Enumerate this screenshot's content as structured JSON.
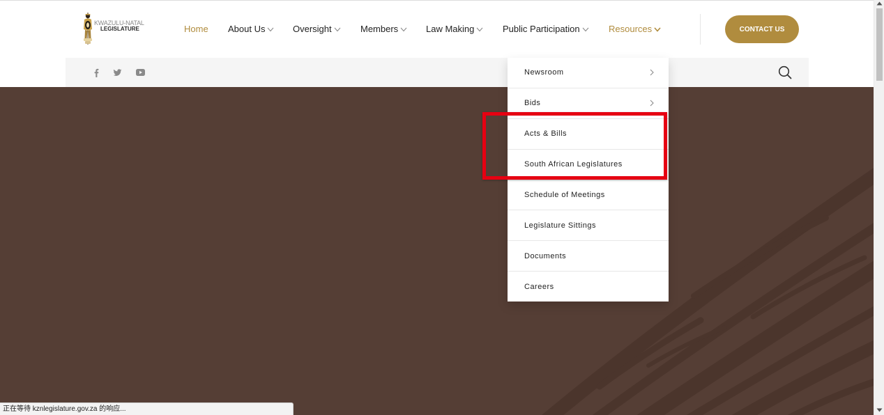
{
  "colors": {
    "accent": "#b08c3e",
    "nav_text": "#222222",
    "hero_background": "#553e35",
    "hero_pattern": "#4a342b",
    "annotation_box": "#e60012"
  },
  "logo": {
    "emblem_icon": "legislature-emblem-icon",
    "line1": "KWAZULU-NATAL",
    "line2": "LEGISLATURE"
  },
  "nav": {
    "items": [
      {
        "label": "Home",
        "active": true,
        "has_dropdown": false
      },
      {
        "label": "About Us",
        "has_dropdown": true
      },
      {
        "label": "Oversight",
        "has_dropdown": true
      },
      {
        "label": "Members",
        "has_dropdown": true
      },
      {
        "label": "Law Making",
        "has_dropdown": true
      },
      {
        "label": "Public Participation",
        "has_dropdown": true
      },
      {
        "label": "Resources",
        "has_dropdown": true,
        "expanded": true
      }
    ]
  },
  "contact_button": {
    "label": "CONTACT US"
  },
  "social_links": [
    {
      "icon": "facebook-icon"
    },
    {
      "icon": "twitter-icon"
    },
    {
      "icon": "youtube-icon"
    }
  ],
  "search": {
    "icon": "search-icon"
  },
  "resources_menu": {
    "items": [
      {
        "label": "Newsroom",
        "has_submenu": true
      },
      {
        "label": "Bids",
        "has_submenu": true
      },
      {
        "label": "Acts & Bills",
        "has_submenu": false,
        "highlighted": true
      },
      {
        "label": "South African Legislatures",
        "has_submenu": false,
        "highlighted": true
      },
      {
        "label": "Schedule of Meetings",
        "has_submenu": false
      },
      {
        "label": "Legislature Sittings",
        "has_submenu": false
      },
      {
        "label": "Documents",
        "has_submenu": false
      },
      {
        "label": "Careers",
        "has_submenu": false
      }
    ]
  },
  "status_bar": {
    "text": "正在等待 kznlegislature.gov.za 的响应..."
  }
}
